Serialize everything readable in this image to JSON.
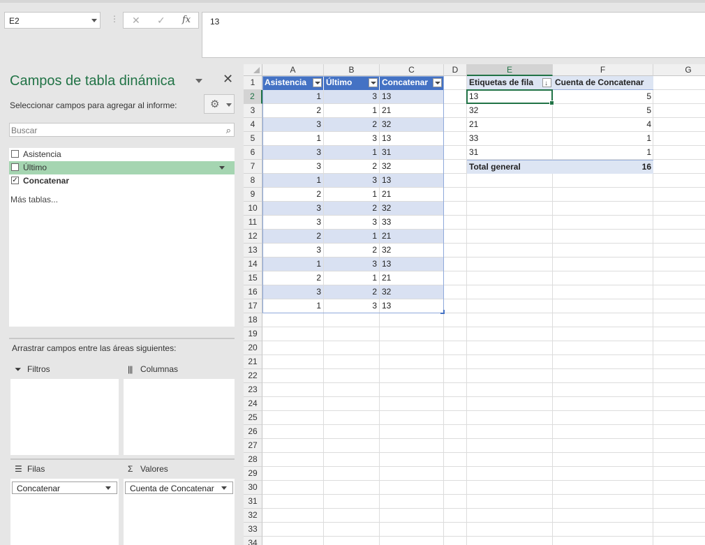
{
  "toolbar": {
    "name_box": "E2",
    "fx_cancel": "✕",
    "fx_enter": "✓",
    "fx_label": "fx",
    "formula_value": "13"
  },
  "pane": {
    "title": "Campos de tabla dinámica",
    "subtitle": "Seleccionar campos para agregar al informe:",
    "search_placeholder": "Buscar",
    "fields": [
      {
        "label": "Asistencia",
        "checked": false
      },
      {
        "label": "Último",
        "checked": false
      },
      {
        "label": "Concatenar",
        "checked": true
      }
    ],
    "more_tables": "Más tablas...",
    "drag_text": "Arrastrar campos entre las áreas siguientes:",
    "areas": {
      "filters": "Filtros",
      "columns": "Columnas",
      "rows": "Filas",
      "values": "Valores",
      "rows_field": "Concatenar",
      "values_field": "Cuenta de Concatenar"
    }
  },
  "grid": {
    "columns": [
      "A",
      "B",
      "C",
      "D",
      "E",
      "F",
      "G"
    ],
    "selected_col": "E",
    "selected_row": 2,
    "table_headers": [
      "Asistencia",
      "Último",
      "Concatenar"
    ],
    "table_rows": [
      [
        1,
        3,
        "13"
      ],
      [
        2,
        1,
        "21"
      ],
      [
        3,
        2,
        "32"
      ],
      [
        1,
        3,
        "13"
      ],
      [
        3,
        1,
        "31"
      ],
      [
        3,
        2,
        "32"
      ],
      [
        1,
        3,
        "13"
      ],
      [
        2,
        1,
        "21"
      ],
      [
        3,
        2,
        "32"
      ],
      [
        3,
        3,
        "33"
      ],
      [
        2,
        1,
        "21"
      ],
      [
        3,
        2,
        "32"
      ],
      [
        1,
        3,
        "13"
      ],
      [
        2,
        1,
        "21"
      ],
      [
        3,
        2,
        "32"
      ],
      [
        1,
        3,
        "13"
      ]
    ],
    "pivot": {
      "header_label": "Etiquetas de fila",
      "header_value": "Cuenta de Concatenar",
      "rows": [
        [
          "13",
          5
        ],
        [
          "32",
          5
        ],
        [
          "21",
          4
        ],
        [
          "33",
          1
        ],
        [
          "31",
          1
        ]
      ],
      "total_label": "Total general",
      "total_value": 16
    }
  },
  "colors": {
    "accent": "#217346",
    "table_header": "#4472c4",
    "table_band": "#d9e1f2",
    "field_highlight": "#a5d5b1"
  }
}
